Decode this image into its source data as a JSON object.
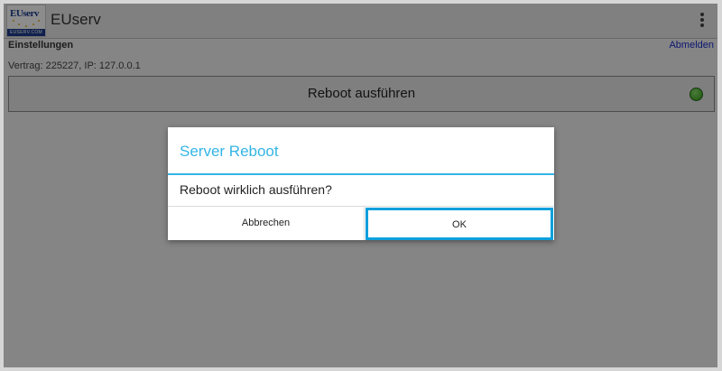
{
  "action_bar": {
    "logo": {
      "top_text": "EUserv",
      "bottom_text": "EUSERV.COM"
    },
    "title": "EUserv",
    "menu_icon": "overflow-menu-icon"
  },
  "links": {
    "settings": "Einstellungen",
    "logout": "Abmelden"
  },
  "contract_info": "Vertrag: 225227, IP: 127.0.0.1",
  "reboot_button": {
    "label": "Reboot ausführen",
    "status_color": "#3ca824"
  },
  "dialog": {
    "title": "Server Reboot",
    "message": "Reboot wirklich ausführen?",
    "cancel_label": "Abbrechen",
    "ok_label": "OK",
    "accent_color": "#33b5e5"
  }
}
